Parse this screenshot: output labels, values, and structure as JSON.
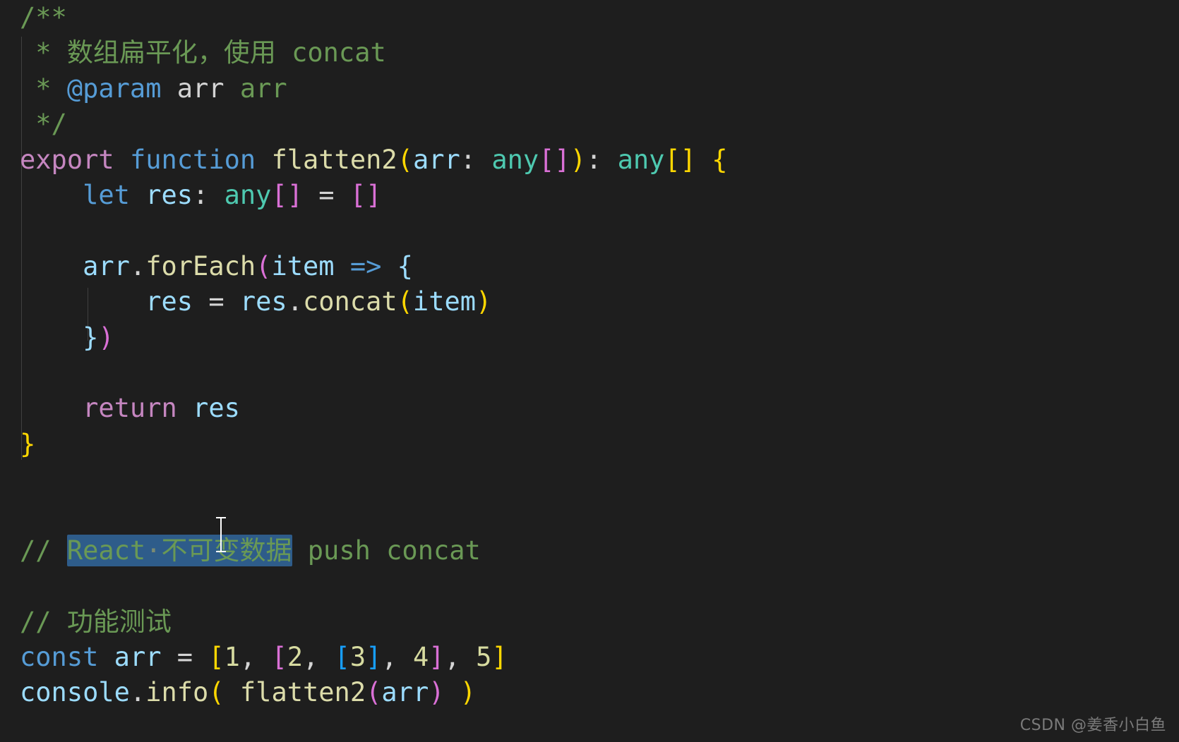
{
  "editor": {
    "theme_background": "#1e1e1e",
    "font_size_px": 37,
    "language": "typescript",
    "selection_color": "#2e5c8a",
    "indent_guide_color": "#404040"
  },
  "code": {
    "line01": "/**",
    "line02_star": " * ",
    "line02_text": "数组扁平化，使用 concat",
    "line03_star": " * ",
    "line03_tag": "@param",
    "line03_name": " arr",
    "line03_desc": " arr",
    "line04": " */",
    "l05_export": "export",
    "l05_function": "function",
    "l05_name": "flatten2",
    "l05_paren_open": "(",
    "l05_arg": "arr",
    "l05_colon": ": ",
    "l05_any": "any",
    "l05_brk": "[]",
    "l05_paren_close": ")",
    "l05_colon2": ": ",
    "l05_ret_any": "any",
    "l05_ret_brk": "[]",
    "l05_brace": "{",
    "l06_let": "let",
    "l06_res": "res",
    "l06_colon": ": ",
    "l06_any": "any",
    "l06_brk": "[]",
    "l06_eq": " = ",
    "l06_empty": "[]",
    "l08_arr": "arr",
    "l08_dot": ".",
    "l08_foreach": "forEach",
    "l08_paren": "(",
    "l08_item": "item",
    "l08_arrow": " => ",
    "l08_brace": "{",
    "l09_res": "res",
    "l09_eq": " = ",
    "l09_res2": "res",
    "l09_dot": ".",
    "l09_concat": "concat",
    "l09_paren": "(",
    "l09_item": "item",
    "l09_paren_close": ")",
    "l10_brace": "}",
    "l10_paren": ")",
    "l12_return": "return",
    "l12_res": " res",
    "l13_brace": "}",
    "l15_slashes": "// ",
    "l15_sel_react": "React",
    "l15_sel_dot": "·",
    "l15_sel_cn": "不可变数据",
    "l15_rest": " push concat",
    "l17_comment": "// 功能测试",
    "l18_const": "const",
    "l18_arr": " arr",
    "l18_eq": " = ",
    "l18_b1o": "[",
    "l18_n1": "1",
    "l18_c1": ", ",
    "l18_b2o": "[",
    "l18_n2": "2",
    "l18_c2": ", ",
    "l18_b3o": "[",
    "l18_n3": "3",
    "l18_b3c": "]",
    "l18_c3": ", ",
    "l18_n4": "4",
    "l18_b2c": "]",
    "l18_c4": ", ",
    "l18_n5": "5",
    "l18_b1c": "]",
    "l19_console": "console",
    "l19_dot": ".",
    "l19_info": "info",
    "l19_paren_o": "(",
    "l19_sp1": " ",
    "l19_fn": "flatten2",
    "l19_paren_o2": "(",
    "l19_arg": "arr",
    "l19_paren_c2": ")",
    "l19_sp2": " ",
    "l19_paren_c": ")"
  },
  "watermark": {
    "text": "CSDN @姜香小白鱼"
  }
}
